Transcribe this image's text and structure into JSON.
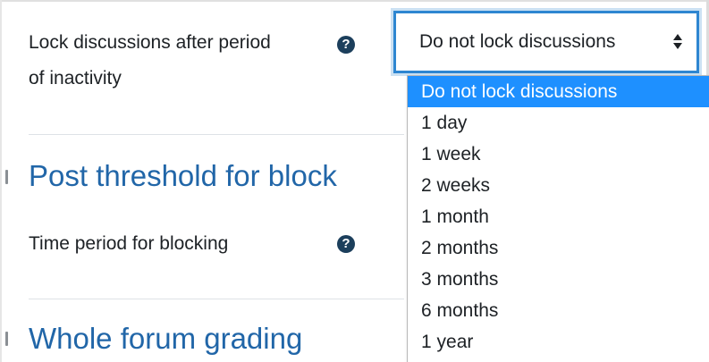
{
  "settings": {
    "lock_discussions": {
      "label": "Lock discussions after period of inactivity",
      "label_line1": "Lock discussions after period",
      "label_line2": "of inactivity",
      "help_icon": "question-circle-icon",
      "selected_value": "Do not lock discussions",
      "options": [
        "Do not lock discussions",
        "1 day",
        "1 week",
        "2 weeks",
        "1 month",
        "2 months",
        "3 months",
        "6 months",
        "1 year"
      ]
    },
    "post_threshold": {
      "heading": "Post threshold for blocking",
      "heading_visible": "Post threshold for block",
      "time_period_label": "Time period for blocking",
      "help_icon": "question-circle-icon"
    },
    "whole_forum_grading": {
      "heading": "Whole forum grading"
    }
  },
  "colors": {
    "heading": "#2166a8",
    "help_icon_bg": "#1c3f5c",
    "focus_border": "#2e86d1",
    "selected_option_bg": "#1e90ff",
    "text": "#1d2125"
  }
}
